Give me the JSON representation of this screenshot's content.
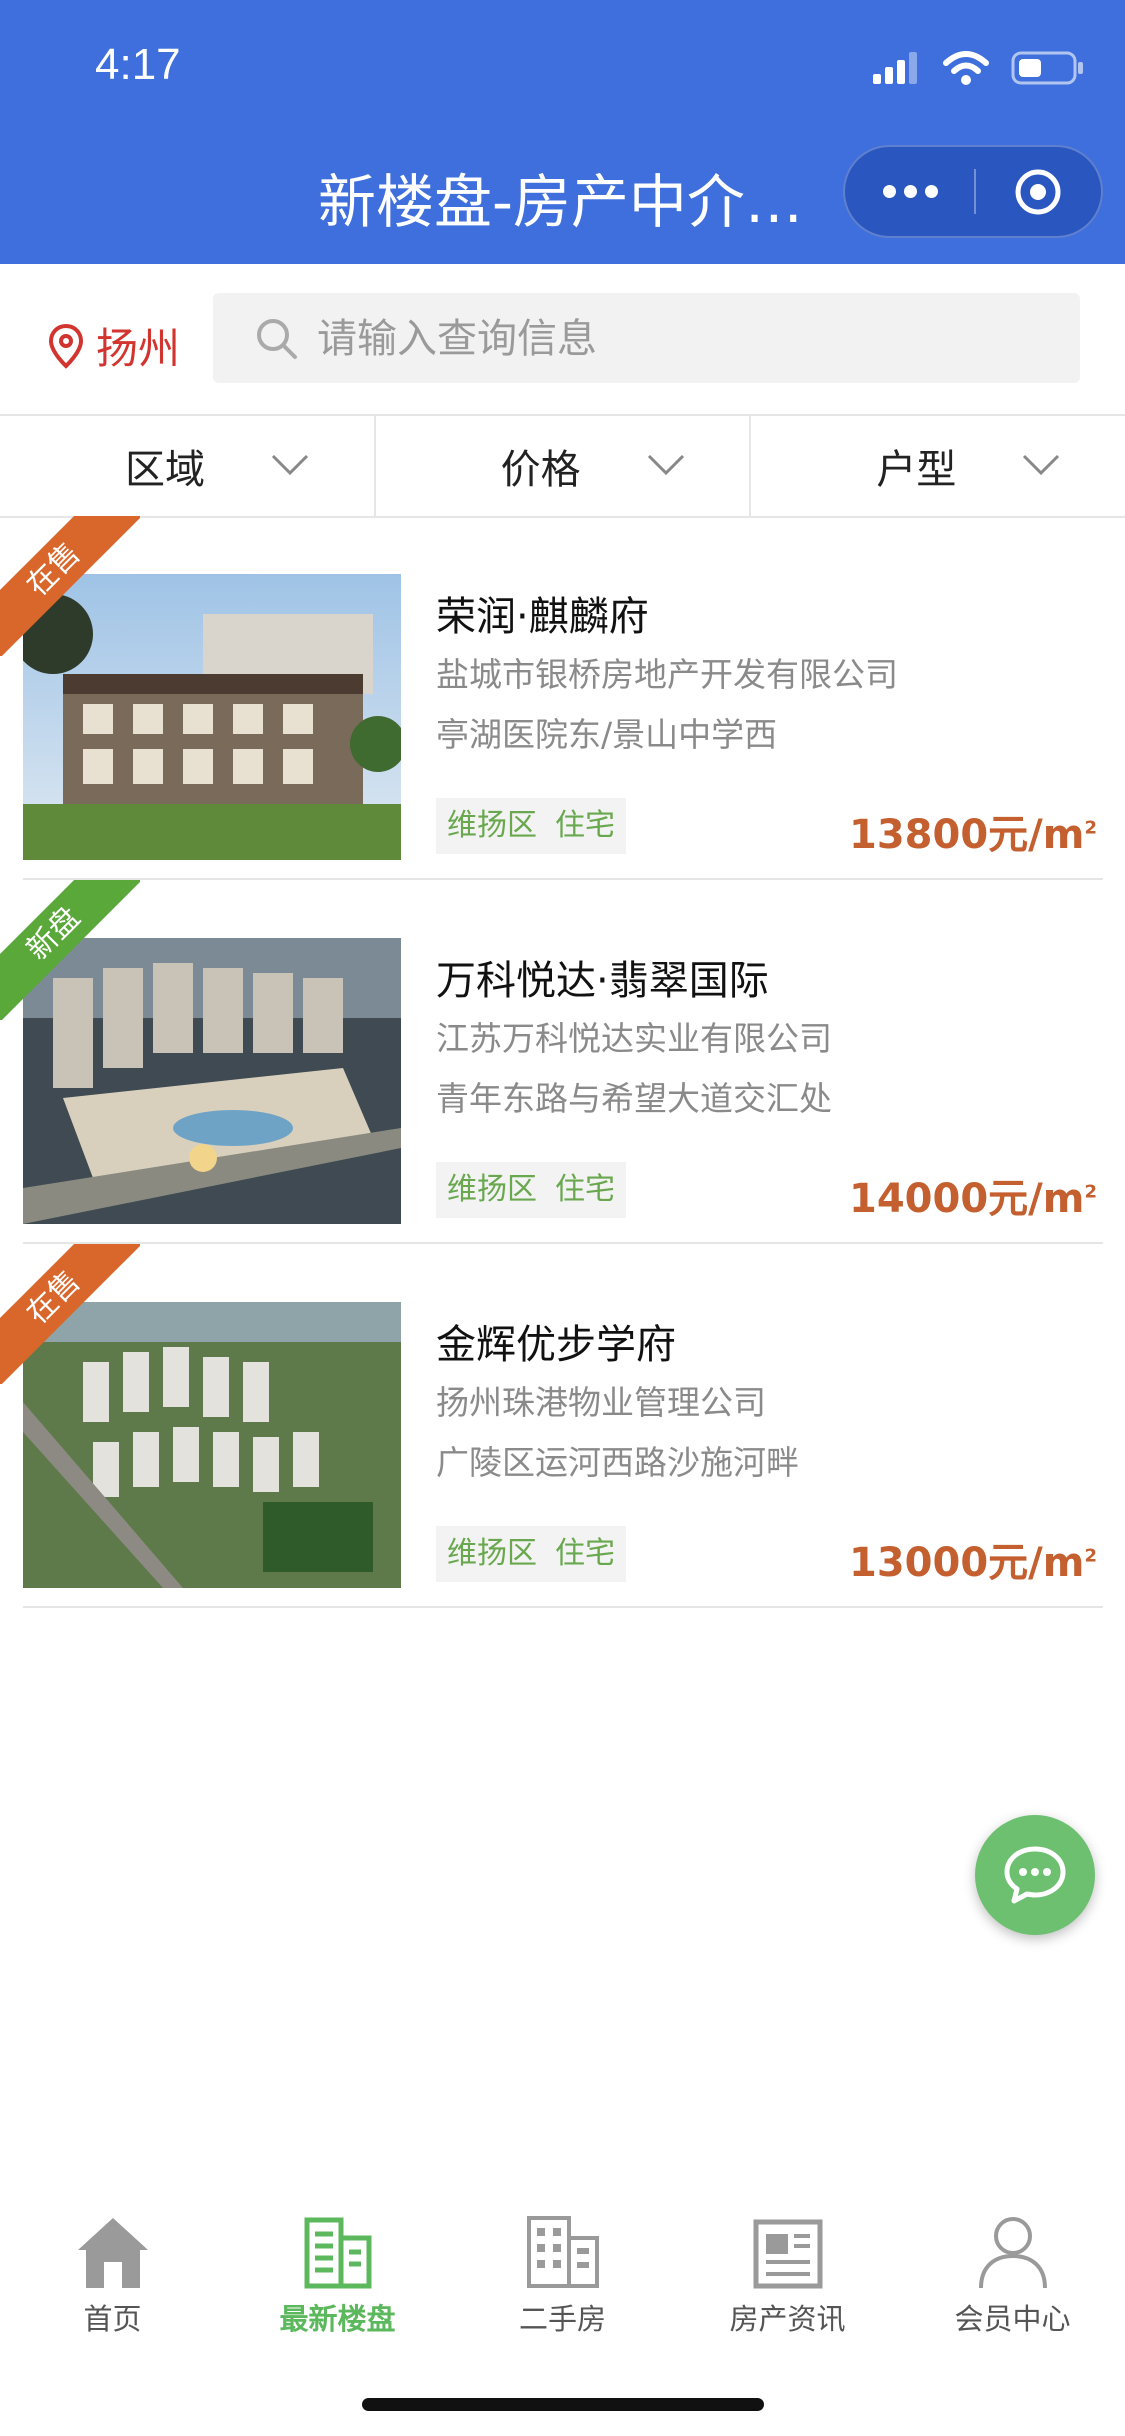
{
  "status_bar": {
    "time": "4:17"
  },
  "header": {
    "title": "新楼盘-房产中介…"
  },
  "location": {
    "city": "扬州"
  },
  "search": {
    "placeholder": "请输入查询信息"
  },
  "filters": [
    {
      "label": "区域"
    },
    {
      "label": "价格"
    },
    {
      "label": "户型"
    }
  ],
  "listings": [
    {
      "badge": "在售",
      "badge_color": "#d9672c",
      "name": "荣润·麒麟府",
      "developer": "盐城市银桥房地产开发有限公司",
      "address": "亭湖医院东/景山中学西",
      "tags": [
        "维扬区",
        "住宅"
      ],
      "price": "13800元/m",
      "price_unit_sup": "2"
    },
    {
      "badge": "新盘",
      "badge_color": "#5aa83a",
      "name": "万科悦达·翡翠国际",
      "developer": "江苏万科悦达实业有限公司",
      "address": "青年东路与希望大道交汇处",
      "tags": [
        "维扬区",
        "住宅"
      ],
      "price": "14000元/m",
      "price_unit_sup": "2"
    },
    {
      "badge": "在售",
      "badge_color": "#d9672c",
      "name": "金辉优步学府",
      "developer": "扬州珠港物业管理公司",
      "address": "广陵区运河西路沙施河畔",
      "tags": [
        "维扬区",
        "住宅"
      ],
      "price": "13000元/m",
      "price_unit_sup": "2"
    }
  ],
  "tabbar": [
    {
      "label": "首页",
      "icon": "home-icon",
      "active": false
    },
    {
      "label": "最新楼盘",
      "icon": "building-icon",
      "active": true
    },
    {
      "label": "二手房",
      "icon": "apartment-icon",
      "active": false
    },
    {
      "label": "房产资讯",
      "icon": "newspaper-icon",
      "active": false
    },
    {
      "label": "会员中心",
      "icon": "user-icon",
      "active": false
    }
  ],
  "colors": {
    "header_bg": "#3f6fdc",
    "accent_red": "#d2352f",
    "price": "#c4602f",
    "tag_text": "#6aa84f",
    "tab_active": "#5cb85c"
  }
}
